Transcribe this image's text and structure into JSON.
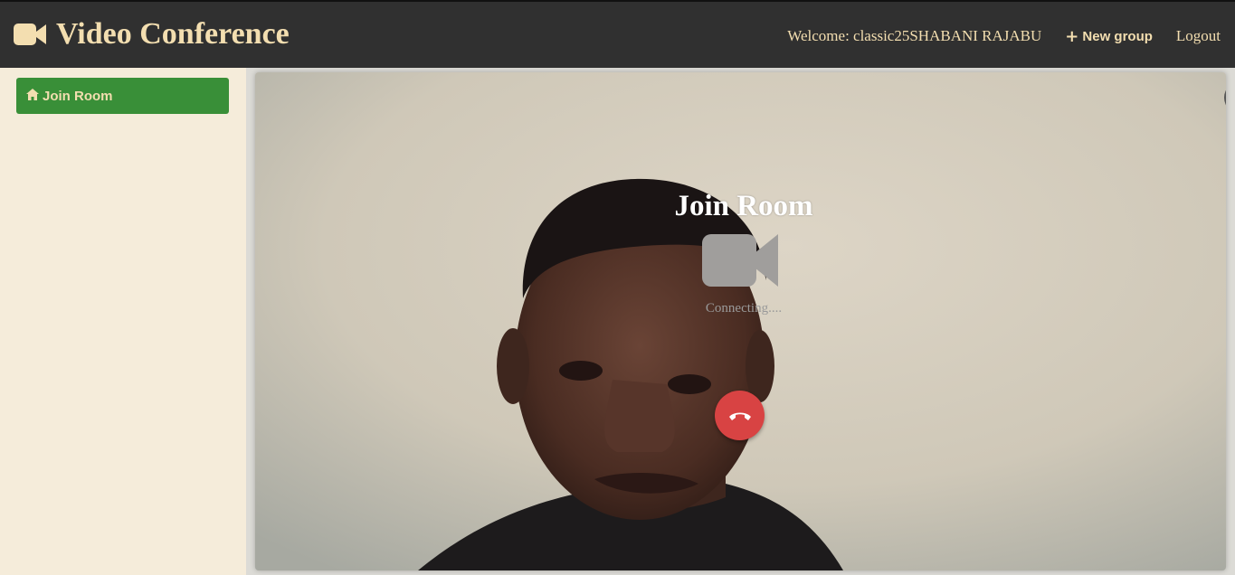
{
  "header": {
    "brand_icon": "video-camera-icon",
    "title": "Video Conference",
    "welcome": "Welcome: classic25SHABANI RAJABU",
    "new_group_icon": "plus-icon",
    "new_group_label": "New group",
    "logout_label": "Logout",
    "bar_color": "#303030",
    "accent_color": "#f3deb0"
  },
  "sidebar": {
    "items": [
      {
        "icon": "home-icon",
        "label": "Join Room",
        "color": "#398f38"
      }
    ]
  },
  "call": {
    "title": "Join Room",
    "camera_icon": "video-camera-icon",
    "status": "Connecting....",
    "hangup_icon": "phone-hangup-icon",
    "hangup_color": "#d84343",
    "collapse_icon": "chevron-left-icon"
  }
}
